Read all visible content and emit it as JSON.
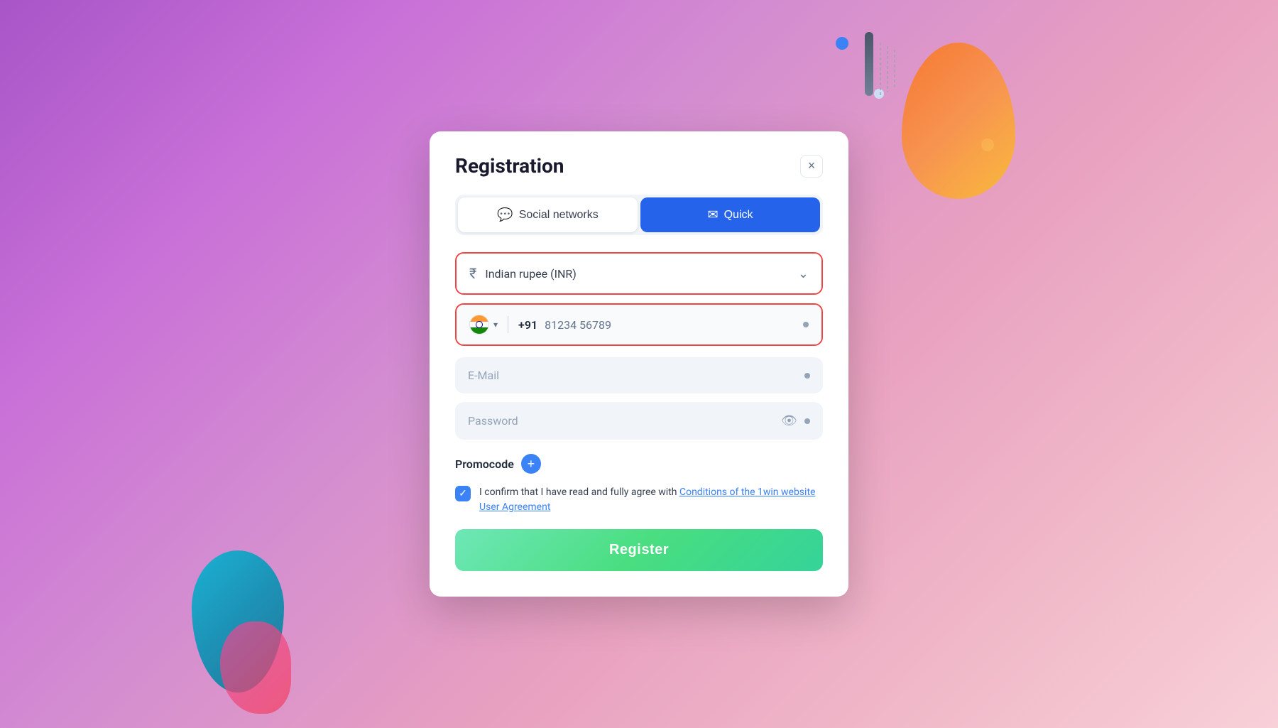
{
  "background": {
    "gradient": "purple to pink"
  },
  "modal": {
    "title": "Registration",
    "close_label": "×",
    "tabs": [
      {
        "id": "social",
        "label": "Social networks",
        "icon": "💬",
        "active": false
      },
      {
        "id": "quick",
        "label": "Quick",
        "icon": "✉",
        "active": true
      }
    ],
    "currency_field": {
      "icon": "₹",
      "value": "Indian rupee (INR)",
      "has_red_border": true
    },
    "phone_field": {
      "country_code": "+91",
      "placeholder": "81234 56789",
      "has_red_border": true
    },
    "email_field": {
      "placeholder": "E-Mail"
    },
    "password_field": {
      "placeholder": "Password"
    },
    "promocode": {
      "label": "Promocode",
      "add_icon": "+"
    },
    "agreement": {
      "text_before_link": "I confirm that I have read and fully agree with ",
      "link_text": "Conditions of the 1win website User Agreement",
      "checked": true
    },
    "register_button": {
      "label": "Register"
    }
  }
}
